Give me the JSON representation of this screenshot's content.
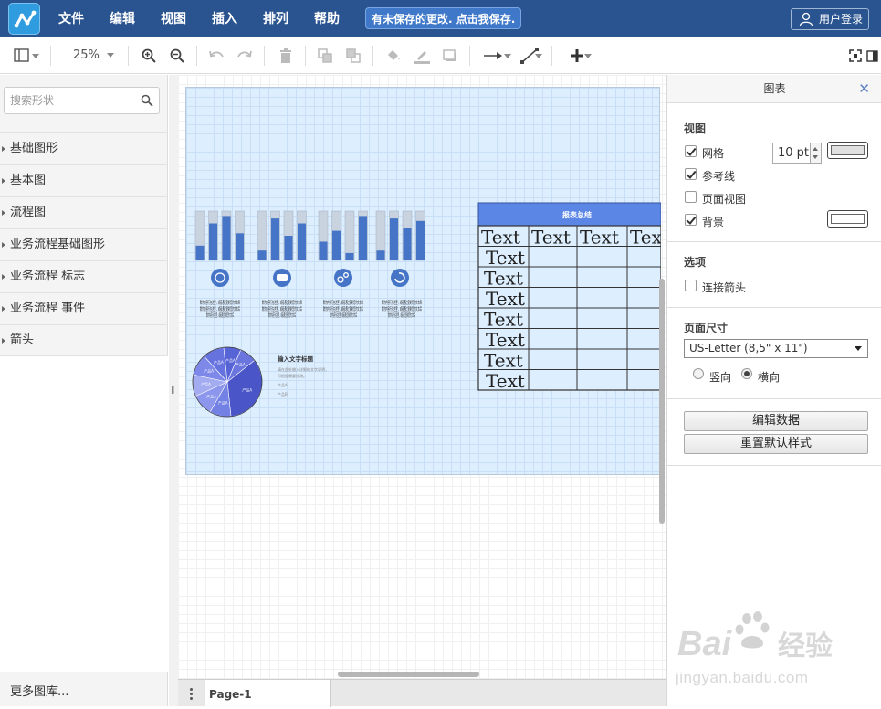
{
  "menubar": {
    "items": [
      "文件",
      "编辑",
      "视图",
      "插入",
      "排列",
      "帮助"
    ],
    "unsaved_notice": "有未保存的更改. 点击我保存.",
    "login_label": "用户登录"
  },
  "toolbar": {
    "zoom": "25%"
  },
  "sidebar": {
    "search_placeholder": "搜索形状",
    "categories": [
      "基础图形",
      "基本图",
      "流程图",
      "业务流程基础图形",
      "业务流程 标志",
      "业务流程 事件",
      "箭头"
    ],
    "more_label": "更多图库..."
  },
  "canvas": {
    "caption": "数的内容行在这里，或者通过复制您的文本后",
    "pie_slice_label": "产品A",
    "pie_title": "输入文字标题",
    "pie_desc": [
      "请在此处输入详细的文字说明，",
      "可根据需要修改。"
    ],
    "pie_notes": [
      "产品A",
      "产品B"
    ],
    "table_title": "报表总结",
    "table_cell_text": "Text",
    "table_header": [
      "Text",
      "Text",
      "Text",
      "Tex"
    ],
    "table_column_cells": [
      "Text",
      "Text",
      "Text",
      "Text",
      "Text",
      "Text",
      "Text"
    ],
    "icons": [
      "globe-icon",
      "chat-icon",
      "gears-icon",
      "refresh-icon"
    ]
  },
  "pagebar": {
    "tab": "Page-1"
  },
  "panel": {
    "title": "图表",
    "view_section": "视图",
    "grid_label": "网格",
    "grid_checked": true,
    "grid_size": "10 pt",
    "guides_label": "参考线",
    "guides_checked": true,
    "pageview_label": "页面视图",
    "pageview_checked": false,
    "background_label": "背景",
    "background_checked": true,
    "options_section": "选项",
    "connect_arrows_label": "连接箭头",
    "connect_arrows_checked": false,
    "page_size_section": "页面尺寸",
    "page_size_value": "US-Letter (8,5\" x 11\")",
    "portrait_label": "竖向",
    "landscape_label": "横向",
    "orientation": "landscape",
    "edit_data_button": "编辑数据",
    "reset_style_button": "重置默认样式"
  },
  "watermark": {
    "brand": "Bai经验",
    "url": "jingyan.baidu.com"
  },
  "colors": {
    "menubar": "#2a5490",
    "bar_fill": "#4674c6",
    "bar_track": "#c9d3df",
    "pie": "#5a6ed6",
    "table_header": "#5b86e5"
  }
}
